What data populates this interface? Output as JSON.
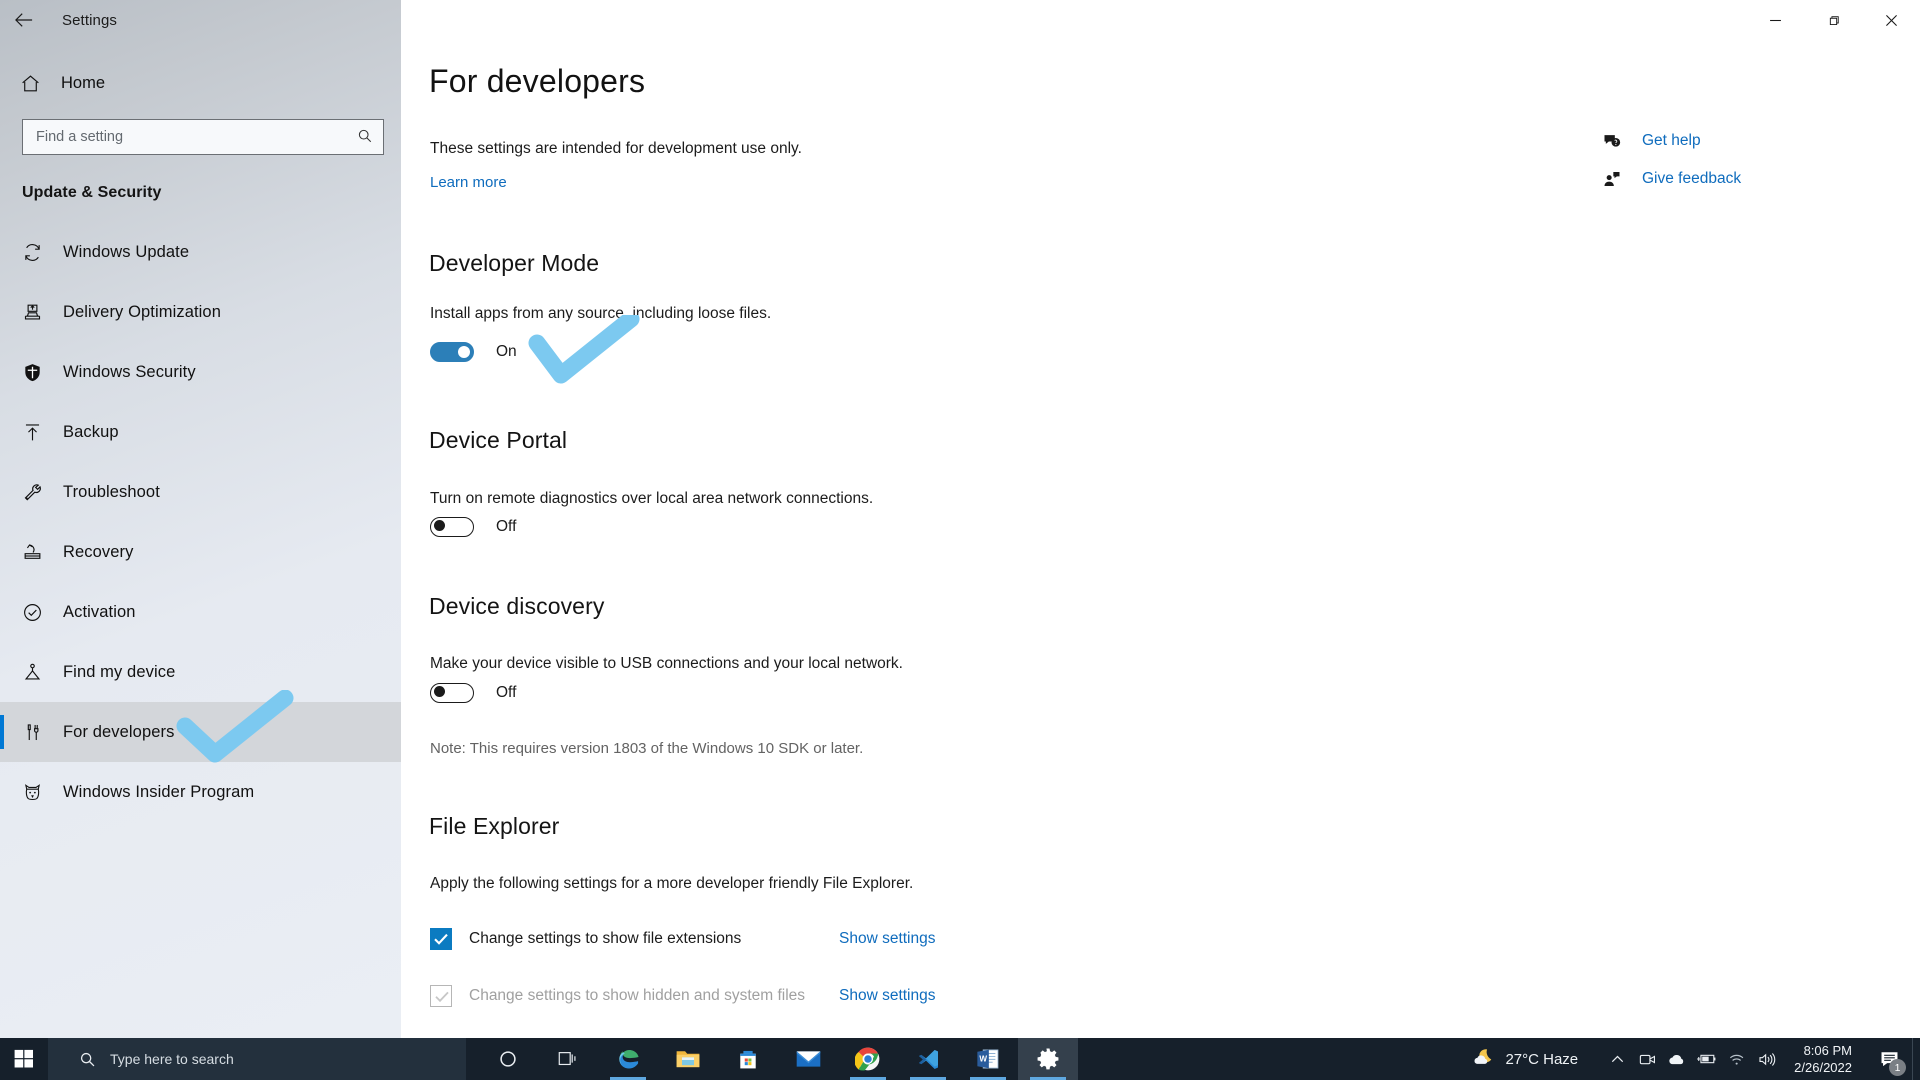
{
  "window": {
    "title": "Settings",
    "back_icon": "back-arrow-icon",
    "minimize_label": "Minimize",
    "maximize_label": "Restore",
    "close_label": "Close"
  },
  "sidebar": {
    "home_label": "Home",
    "home_icon": "home-icon",
    "search": {
      "placeholder": "Find a setting",
      "value": "",
      "icon": "search-icon"
    },
    "group_title": "Update & Security",
    "items": [
      {
        "label": "Windows Update",
        "icon": "refresh-icon",
        "selected": false
      },
      {
        "label": "Delivery Optimization",
        "icon": "delivery-icon",
        "selected": false
      },
      {
        "label": "Windows Security",
        "icon": "shield-icon",
        "selected": false
      },
      {
        "label": "Backup",
        "icon": "upload-arrow-icon",
        "selected": false
      },
      {
        "label": "Troubleshoot",
        "icon": "wrench-icon",
        "selected": false
      },
      {
        "label": "Recovery",
        "icon": "recovery-icon",
        "selected": false
      },
      {
        "label": "Activation",
        "icon": "check-circle-icon",
        "selected": false
      },
      {
        "label": "Find my device",
        "icon": "location-person-icon",
        "selected": false
      },
      {
        "label": "For developers",
        "icon": "tools-icon",
        "selected": true
      },
      {
        "label": "Windows Insider Program",
        "icon": "insider-cat-icon",
        "selected": false
      }
    ]
  },
  "main": {
    "page_title": "For developers",
    "intro": "These settings are intended for development use only.",
    "learn_more": "Learn more",
    "help_links": [
      {
        "label": "Get help",
        "icon": "help-bubble-icon"
      },
      {
        "label": "Give feedback",
        "icon": "feedback-person-icon"
      }
    ],
    "sections": [
      {
        "heading": "Developer Mode",
        "description": "Install apps from any source, including loose files.",
        "toggle_state": "on",
        "toggle_label": "On"
      },
      {
        "heading": "Device Portal",
        "description": "Turn on remote diagnostics over local area network connections.",
        "toggle_state": "off",
        "toggle_label": "Off"
      },
      {
        "heading": "Device discovery",
        "description": "Make your device visible to USB connections and your local network.",
        "toggle_state": "off",
        "toggle_label": "Off",
        "note": "Note: This requires version 1803 of the Windows 10 SDK or later."
      }
    ],
    "file_explorer": {
      "heading": "File Explorer",
      "description": "Apply the following settings for a more developer friendly File Explorer.",
      "rows": [
        {
          "label": "Change settings to show file extensions",
          "checked": true,
          "disabled": false,
          "link": "Show settings"
        },
        {
          "label": "Change settings to show hidden and system files",
          "checked": false,
          "disabled": true,
          "link": "Show settings"
        }
      ]
    }
  },
  "annotations": [
    {
      "name": "developer-mode-toggle-checkmark",
      "color": "#7cc9f0"
    },
    {
      "name": "for-developers-nav-checkmark",
      "color": "#7cc9f0"
    }
  ],
  "taskbar": {
    "start_icon": "windows-start-icon",
    "search": {
      "placeholder": "Type here to search",
      "icon": "search-icon"
    },
    "cortana_icon": "cortana-circle-icon",
    "taskview_icon": "task-view-icon",
    "apps": [
      {
        "name": "Microsoft Edge",
        "icon": "edge-icon",
        "running": true,
        "active": false
      },
      {
        "name": "File Explorer",
        "icon": "file-explorer-icon",
        "running": false,
        "active": false
      },
      {
        "name": "Microsoft Store",
        "icon": "microsoft-store-icon",
        "running": false,
        "active": false
      },
      {
        "name": "Mail",
        "icon": "mail-icon",
        "running": false,
        "active": false
      },
      {
        "name": "Google Chrome",
        "icon": "chrome-icon",
        "running": true,
        "active": false
      },
      {
        "name": "Visual Studio Code",
        "icon": "vscode-icon",
        "running": true,
        "active": false
      },
      {
        "name": "Microsoft Word",
        "icon": "word-icon",
        "running": true,
        "active": false
      },
      {
        "name": "Settings",
        "icon": "gear-icon",
        "running": true,
        "active": true
      }
    ],
    "tray": {
      "weather_icon": "moon-cloud-icon",
      "weather_text": "27°C  Haze",
      "chevron_icon": "chevron-up-icon",
      "icons": [
        "camera-icon",
        "onedrive-icon",
        "battery-charging-icon",
        "wifi-icon",
        "volume-icon"
      ],
      "time": "8:06 PM",
      "date": "2/26/2022",
      "notification_icon": "notification-icon",
      "notification_count": "1"
    }
  },
  "colors": {
    "accent": "#0078d4",
    "link": "#0f6cbd",
    "toggle_on": "#2c7fb8",
    "checkbox_checked": "#0b7bc1",
    "annotation": "#7cc9f0",
    "taskbar": "#16202b"
  }
}
